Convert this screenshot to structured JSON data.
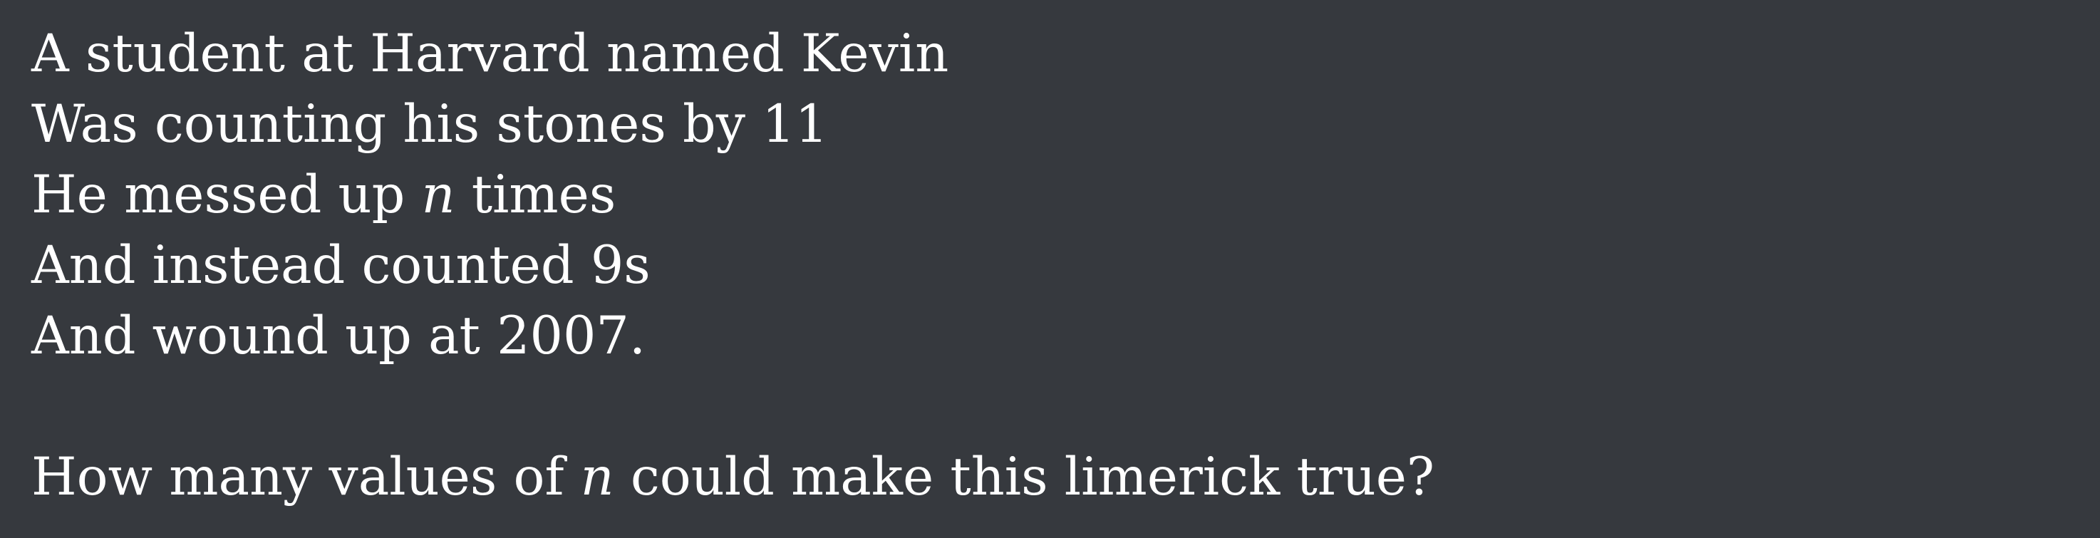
{
  "limerick": {
    "line1": "A student at Harvard named Kevin",
    "line2": "Was counting his stones by 11",
    "line3_before": "He messed up ",
    "line3_var": "n",
    "line3_after": " times",
    "line4": "And instead counted 9s",
    "line5": "And wound up at 2007."
  },
  "question": {
    "before": "How many values of ",
    "var": "n",
    "after": " could make this limerick true?"
  }
}
